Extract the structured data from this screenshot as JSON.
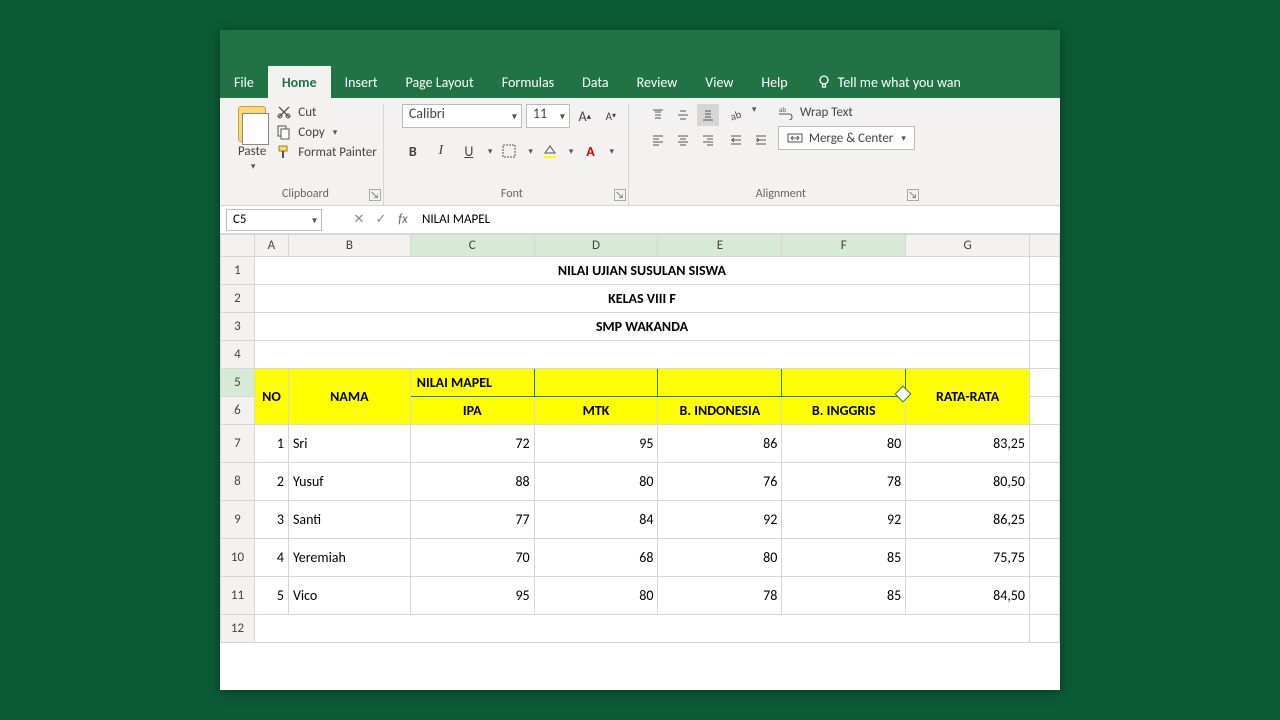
{
  "tabs": {
    "file": "File",
    "home": "Home",
    "insert": "Insert",
    "pagelayout": "Page Layout",
    "formulas": "Formulas",
    "data": "Data",
    "review": "Review",
    "view": "View",
    "help": "Help",
    "tellme": "Tell me what you wan"
  },
  "ribbon": {
    "paste": "Paste",
    "cut": "Cut",
    "copy": "Copy",
    "fmtpaint": "Format Painter",
    "clipboard_label": "Clipboard",
    "font_family": "Calibri",
    "font_size": "11",
    "font_label": "Font",
    "align_label": "Alignment",
    "wrap": "Wrap Text",
    "merge": "Merge & Center"
  },
  "namebox": "C5",
  "formula": "NILAI MAPEL",
  "fx_symbol": "fx",
  "columns": [
    "A",
    "B",
    "C",
    "D",
    "E",
    "F",
    "G"
  ],
  "rows": [
    "1",
    "2",
    "3",
    "4",
    "5",
    "6",
    "7",
    "8",
    "9",
    "10",
    "11",
    "12"
  ],
  "titles": {
    "t1": "NILAI UJIAN SUSULAN SISWA",
    "t2": "KELAS VIII F",
    "t3": "SMP WAKANDA"
  },
  "headers": {
    "no": "NO",
    "nama": "NAMA",
    "nilai": "NILAI MAPEL",
    "ipa": "IPA",
    "mtk": "MTK",
    "bindo": "B. INDONESIA",
    "bing": "B. INGGRIS",
    "rata": "RATA-RATA"
  },
  "chart_data": {
    "type": "table",
    "columns": [
      "NO",
      "NAMA",
      "IPA",
      "MTK",
      "B. INDONESIA",
      "B. INGGRIS",
      "RATA-RATA"
    ],
    "rows": [
      {
        "no": "1",
        "nama": "Sri",
        "ipa": "72",
        "mtk": "95",
        "bindo": "86",
        "bing": "80",
        "rata": "83,25"
      },
      {
        "no": "2",
        "nama": "Yusuf",
        "ipa": "88",
        "mtk": "80",
        "bindo": "76",
        "bing": "78",
        "rata": "80,50"
      },
      {
        "no": "3",
        "nama": "Santi",
        "ipa": "77",
        "mtk": "84",
        "bindo": "92",
        "bing": "92",
        "rata": "86,25"
      },
      {
        "no": "4",
        "nama": "Yeremiah",
        "ipa": "70",
        "mtk": "68",
        "bindo": "80",
        "bing": "85",
        "rata": "75,75"
      },
      {
        "no": "5",
        "nama": "Vico",
        "ipa": "95",
        "mtk": "80",
        "bindo": "78",
        "bing": "85",
        "rata": "84,50"
      }
    ]
  }
}
